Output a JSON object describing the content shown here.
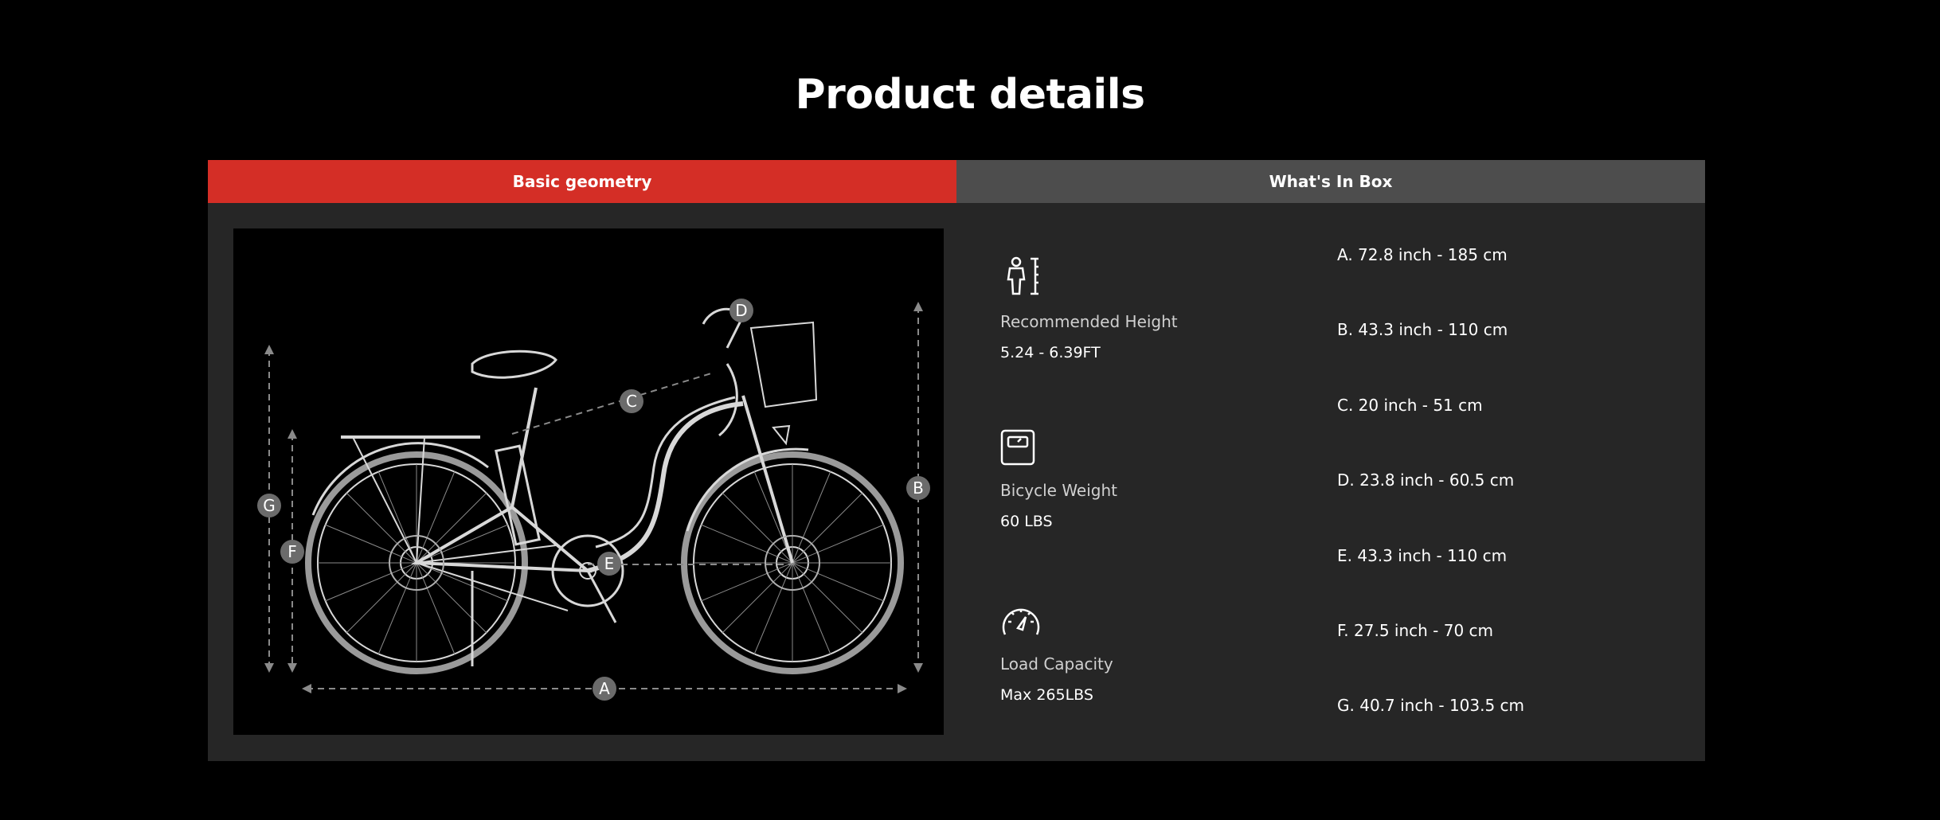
{
  "page": {
    "title": "Product details"
  },
  "tabs": [
    {
      "label": "Basic geometry",
      "active": true
    },
    {
      "label": "What's In Box",
      "active": false
    }
  ],
  "specs": [
    {
      "icon": "person-height-icon",
      "label": "Recommended Height",
      "value": "5.24 - 6.39FT"
    },
    {
      "icon": "scale-weight-icon",
      "label": "Bicycle Weight",
      "value": "60 LBS"
    },
    {
      "icon": "speedometer-icon",
      "label": "Load Capacity",
      "value": "Max 265LBS"
    }
  ],
  "dimensions": [
    "A. 72.8 inch - 185 cm",
    "B. 43.3 inch - 110 cm",
    "C. 20 inch - 51 cm",
    "D. 23.8 inch - 60.5 cm",
    "E. 43.3 inch - 110 cm",
    "F. 27.5 inch - 70 cm",
    "G. 40.7 inch - 103.5 cm"
  ],
  "diagram_markers": [
    "A",
    "B",
    "C",
    "D",
    "E",
    "F",
    "G"
  ],
  "colors": {
    "background": "#000000",
    "active_tab": "#d42e26",
    "inactive_tab": "#4d4d4d",
    "panel": "#262626",
    "marker": "#6b6b6b"
  }
}
